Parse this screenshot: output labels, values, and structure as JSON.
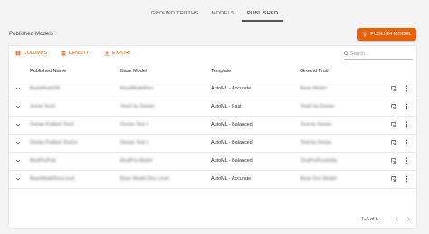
{
  "nav": {
    "tabs": [
      {
        "label": "GROUND TRUTHS",
        "active": false
      },
      {
        "label": "MODELS",
        "active": false
      },
      {
        "label": "PUBLISHED",
        "active": true
      }
    ]
  },
  "page": {
    "title": "Published Models",
    "publish_button": "PUBLISH MODEL"
  },
  "toolbar": {
    "columns": "COLUMNS",
    "density": "DENSITY",
    "export": "EXPORT",
    "search_placeholder": "Search…"
  },
  "table": {
    "columns": [
      "Published Name",
      "Base Model",
      "Template",
      "Ground Truth"
    ],
    "rows": [
      {
        "name": "BaseModel2E",
        "base": "BaseModelDoc",
        "template": "AutoML - Accurate",
        "ground_truth": "Base Model"
      },
      {
        "name": "Some Test2",
        "base": "Test2 by Dorian",
        "template": "AutoML - Fast",
        "ground_truth": "Test2 by Dorian"
      },
      {
        "name": "Dorian Publish Test1",
        "base": "Dorian Test 1",
        "template": "AutoML - Balanced",
        "ground_truth": "Test by Dorian"
      },
      {
        "name": "Dorian Publish Test1a",
        "base": "Dorian Test 1",
        "template": "AutoML - Balanced",
        "ground_truth": "Test by Dorian"
      },
      {
        "name": "BestProPub",
        "base": "BestPro Model",
        "template": "AutoML - Balanced",
        "ground_truth": "TestProProximity"
      },
      {
        "name": "BaseModelDocLevel",
        "base": "Base Model Doc Level",
        "template": "AutoML - Accurate",
        "ground_truth": "Base Doc Model"
      }
    ]
  },
  "pagination": {
    "range": "1–6 of 6"
  },
  "colors": {
    "accent": "#e8600a",
    "background": "#f4f4f4"
  }
}
